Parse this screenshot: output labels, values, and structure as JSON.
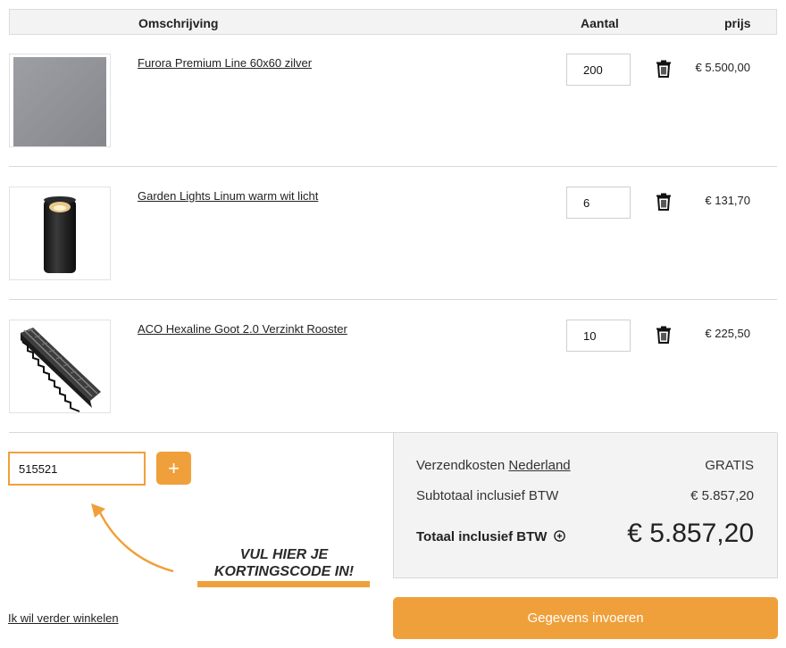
{
  "table_header": {
    "description": "Omschrijving",
    "quantity": "Aantal",
    "price": "prijs"
  },
  "items": [
    {
      "name": "Furora Premium Line 60x60 zilver",
      "quantity": "200",
      "price": "€ 5.500,00",
      "image": "grey-tile-image"
    },
    {
      "name": "Garden Lights Linum warm wit licht",
      "quantity": "6",
      "price": "€ 131,70",
      "image": "garden-light-image"
    },
    {
      "name": "ACO Hexaline Goot 2.0 Verzinkt Rooster",
      "quantity": "10",
      "price": "€ 225,50",
      "image": "drain-gutter-image"
    }
  ],
  "coupon": {
    "value": "515521",
    "add_label": "+",
    "hint_line1": "VUL HIER JE",
    "hint_line2": "KORTINGSCODE IN!"
  },
  "summary": {
    "shipping_label": "Verzendkosten",
    "shipping_country": "Nederland",
    "shipping_value": "GRATIS",
    "subtotal_label": "Subtotaal inclusief BTW",
    "subtotal_value": "€ 5.857,20",
    "total_label": "Totaal inclusief BTW",
    "total_value": "€ 5.857,20"
  },
  "continue_label": "Ik wil verder winkelen",
  "submit_label": "Gegevens invoeren",
  "colors": {
    "accent": "#f0a03a",
    "panel_bg": "#f3f3f3"
  },
  "icons": [
    "trash-icon",
    "info-circle-icon",
    "arrow-icon"
  ]
}
